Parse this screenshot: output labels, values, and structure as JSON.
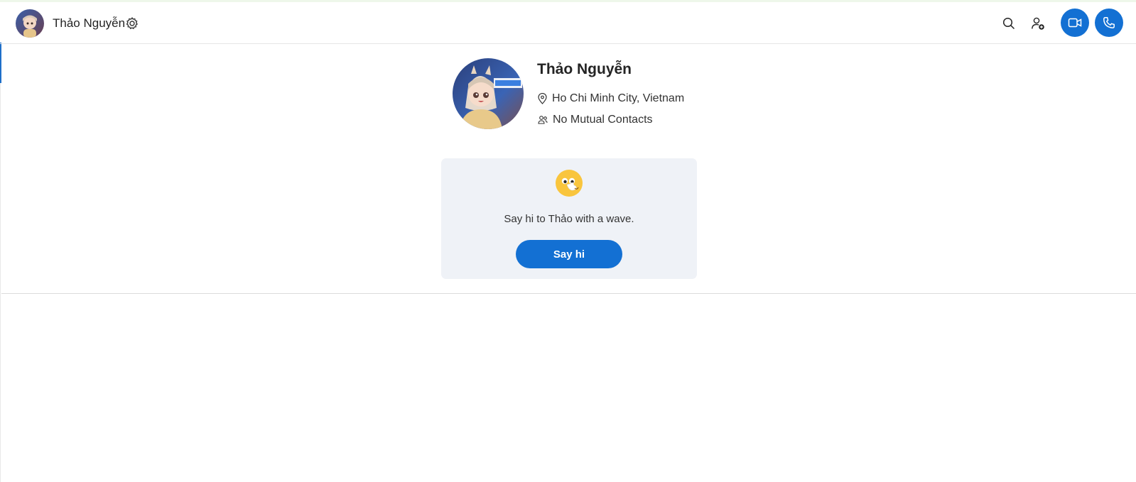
{
  "header": {
    "contact_name": "Thảo Nguyễn",
    "avatar_icon": "contact-avatar",
    "settings_icon": "gear-icon",
    "actions": {
      "search_icon": "search-icon",
      "add_people_icon": "add-person-icon",
      "video_call_icon": "video-camera-icon",
      "audio_call_icon": "phone-icon"
    }
  },
  "profile": {
    "name": "Thảo Nguyễn",
    "location": "Ho Chi Minh City, Vietnam",
    "mutual_contacts": "No Mutual Contacts"
  },
  "wave_card": {
    "emoji": "waving-hand-emoji",
    "message": "Say hi to Thảo with a wave.",
    "button_label": "Say hi"
  },
  "colors": {
    "accent": "#1370d3",
    "card_background": "#eff2f7"
  }
}
